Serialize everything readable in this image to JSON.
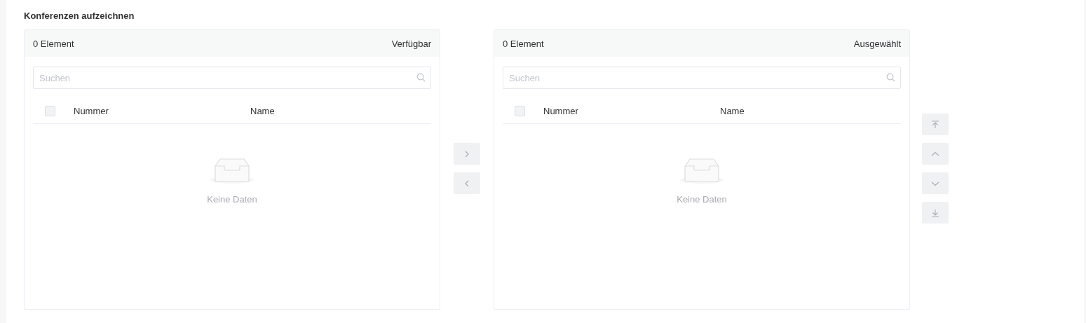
{
  "title": "Konferenzen aufzeichnen",
  "panels": [
    {
      "count": "0 Element",
      "heading": "Verfügbar",
      "search": {
        "placeholder": "Suchen"
      },
      "select_all": {
        "checked": false
      },
      "columns": [
        "Nummer",
        "Name"
      ],
      "empty_text": "Keine Daten"
    },
    {
      "count": "0 Element",
      "heading": "Ausgewählt",
      "search": {
        "placeholder": "Suchen"
      },
      "select_all": {
        "checked": false
      },
      "columns": [
        "Nummer",
        "Name"
      ],
      "empty_text": "Keine Daten"
    }
  ],
  "transfer_buttons": [
    {
      "kind": "right",
      "disabled": true
    },
    {
      "kind": "left",
      "disabled": true
    }
  ],
  "order_buttons": [
    {
      "kind": "top",
      "disabled": true
    },
    {
      "kind": "up",
      "disabled": true
    },
    {
      "kind": "down",
      "disabled": true
    },
    {
      "kind": "bottom",
      "disabled": true
    }
  ]
}
